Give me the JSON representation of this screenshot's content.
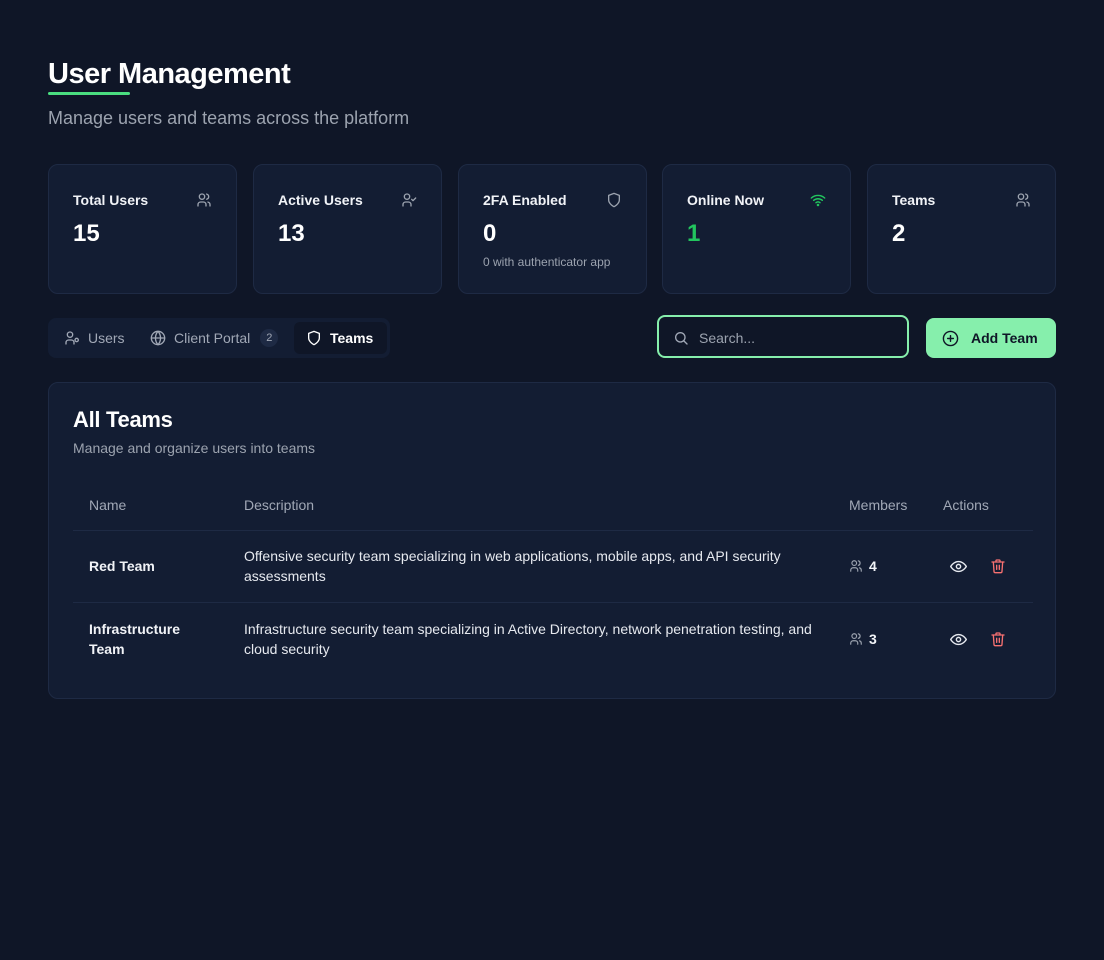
{
  "header": {
    "title": "User Management",
    "subtitle": "Manage users and teams across the platform"
  },
  "stats": [
    {
      "label": "Total Users",
      "value": "15",
      "sub": "",
      "icon": "users-icon"
    },
    {
      "label": "Active Users",
      "value": "13",
      "sub": "",
      "icon": "user-check-icon"
    },
    {
      "label": "2FA Enabled",
      "value": "0",
      "sub": "0 with authenticator app",
      "icon": "shield-icon"
    },
    {
      "label": "Online Now",
      "value": "1",
      "sub": "",
      "icon": "wifi-icon"
    },
    {
      "label": "Teams",
      "value": "2",
      "sub": "",
      "icon": "users-icon"
    }
  ],
  "tabs": [
    {
      "label": "Users",
      "icon": "user-icon",
      "badge": ""
    },
    {
      "label": "Client Portal",
      "icon": "globe-icon",
      "badge": "2"
    },
    {
      "label": "Teams",
      "icon": "shield-icon",
      "badge": "",
      "active": true
    }
  ],
  "search": {
    "placeholder": "Search...",
    "value": ""
  },
  "add_button": {
    "label": "Add Team",
    "icon": "plus-circle-icon"
  },
  "panel": {
    "title": "All Teams",
    "subtitle": "Manage and organize users into teams",
    "columns": {
      "name": "Name",
      "description": "Description",
      "members": "Members",
      "actions": "Actions"
    },
    "rows": [
      {
        "name": "Red Team",
        "description": "Offensive security team specializing in web applications, mobile apps, and API security assessments",
        "members": "4"
      },
      {
        "name": "Infrastructure Team",
        "description": "Infrastructure security team specializing in Active Directory, network penetration testing, and cloud security",
        "members": "3"
      }
    ]
  },
  "colors": {
    "background": "#0f1627",
    "card": "#131d33",
    "accent": "#86efac",
    "online": "#22c55e",
    "danger": "#f87171"
  }
}
